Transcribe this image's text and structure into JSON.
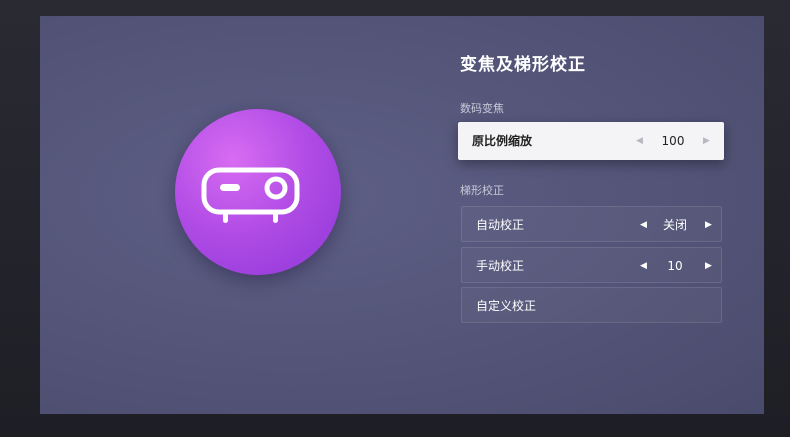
{
  "panel": {
    "title": "变焦及梯形校正"
  },
  "zoom_section": {
    "label": "数码变焦",
    "items": [
      {
        "label": "原比例缩放",
        "value": "100",
        "left_arrow": "◀",
        "right_arrow": "▶"
      }
    ]
  },
  "keystone_section": {
    "label": "梯形校正",
    "items": [
      {
        "label": "自动校正",
        "value": "关闭",
        "left_arrow": "◀",
        "right_arrow": "▶"
      },
      {
        "label": "手动校正",
        "value": "10",
        "left_arrow": "◀",
        "right_arrow": "▶"
      },
      {
        "label": "自定义校正"
      }
    ]
  },
  "icon": {
    "name": "projector-icon",
    "gradient_start": "#d86cf2",
    "gradient_end": "#8e36d8"
  },
  "colors": {
    "screen_bg": "#55567a",
    "focused_row_bg": "#f4f4f7"
  }
}
